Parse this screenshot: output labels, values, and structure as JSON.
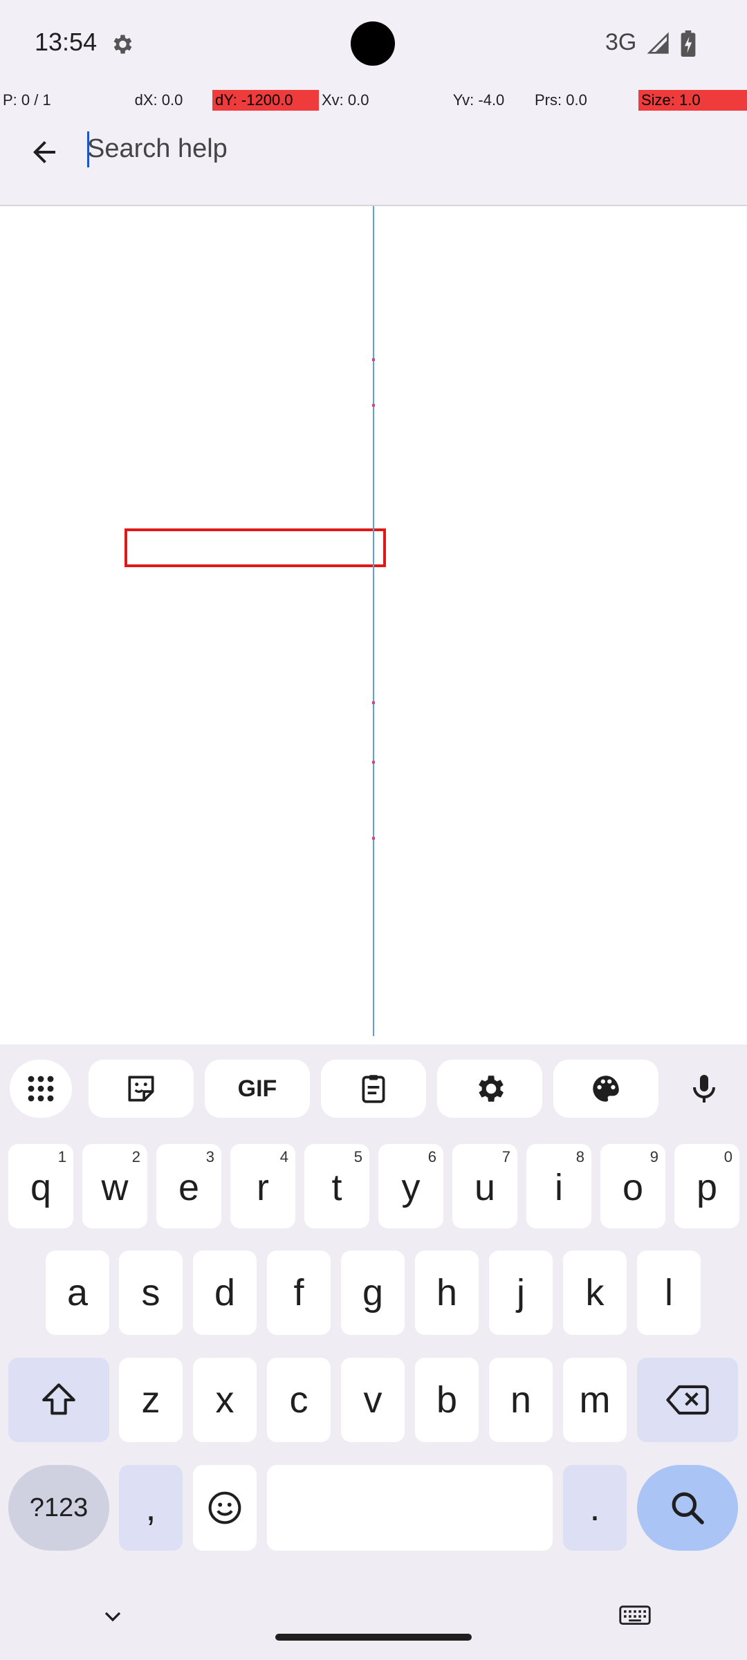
{
  "status": {
    "time": "13:54",
    "network": "3G"
  },
  "debug": {
    "p": "P: 0 / 1",
    "dx": "dX: 0.0",
    "dy": "dY: -1200.0",
    "xv": "Xv: 0.0",
    "yv": "Yv: -4.0",
    "prs": "Prs: 0.0",
    "size": "Size: 1.0"
  },
  "header": {
    "search_placeholder": "Search help"
  },
  "keyboard": {
    "row1": [
      {
        "key": "q",
        "hint": "1"
      },
      {
        "key": "w",
        "hint": "2"
      },
      {
        "key": "e",
        "hint": "3"
      },
      {
        "key": "r",
        "hint": "4"
      },
      {
        "key": "t",
        "hint": "5"
      },
      {
        "key": "y",
        "hint": "6"
      },
      {
        "key": "u",
        "hint": "7"
      },
      {
        "key": "i",
        "hint": "8"
      },
      {
        "key": "o",
        "hint": "9"
      },
      {
        "key": "p",
        "hint": "0"
      }
    ],
    "row2": [
      "a",
      "s",
      "d",
      "f",
      "g",
      "h",
      "j",
      "k",
      "l"
    ],
    "row3": [
      "z",
      "x",
      "c",
      "v",
      "b",
      "n",
      "m"
    ],
    "symbols_label": "?123",
    "comma_label": ",",
    "period_label": ".",
    "gif_label": "GIF"
  },
  "colors": {
    "accent": "#1a56c8",
    "debug_highlight": "#ef3b3b",
    "keyboard_bg": "#efecf4",
    "modifier_key": "#dde0f5"
  }
}
